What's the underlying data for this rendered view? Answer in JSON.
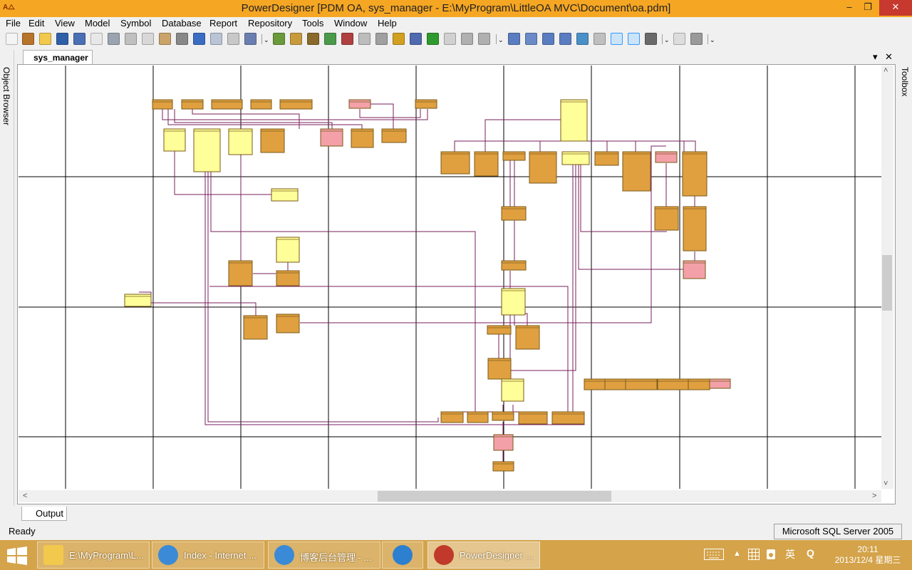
{
  "window": {
    "app_icon_text": "A⧍",
    "title": "PowerDesigner [PDM OA, sys_manager - E:\\MyProgram\\LittleOA MVC\\Document\\oa.pdm]",
    "minimize_glyph": "–",
    "restore_glyph": "❐",
    "close_glyph": "✕"
  },
  "menu": [
    {
      "label": "File"
    },
    {
      "label": "Edit"
    },
    {
      "label": "View"
    },
    {
      "label": "Model"
    },
    {
      "label": "Symbol"
    },
    {
      "label": "Database"
    },
    {
      "label": "Report"
    },
    {
      "label": "Repository"
    },
    {
      "label": "Tools"
    },
    {
      "label": "Window"
    },
    {
      "label": "Help"
    }
  ],
  "toolbar": {
    "overflow_glyph": "⌄",
    "buttons": [
      {
        "icon": "new-model-icon",
        "color": "#f4f4f4"
      },
      {
        "icon": "new-project-icon",
        "color": "#b8742a"
      },
      {
        "icon": "open-folder-icon",
        "color": "#f2c94c"
      },
      {
        "icon": "save-icon",
        "color": "#2f5fa8"
      },
      {
        "icon": "save-all-icon",
        "color": "#4a6fb5"
      },
      {
        "icon": "print-preview-icon",
        "color": "#e8e8e8"
      },
      {
        "icon": "print-icon",
        "color": "#9aa4b0"
      },
      {
        "icon": "cut-icon",
        "color": "#c0c0c0"
      },
      {
        "icon": "copy-icon",
        "color": "#d8d8d8"
      },
      {
        "icon": "paste-icon",
        "color": "#c9a36a"
      },
      {
        "icon": "delete-icon",
        "color": "#888888"
      },
      {
        "icon": "undo-icon",
        "color": "#3a6cc4"
      },
      {
        "icon": "redo-icon",
        "color": "#b9c4d6"
      },
      {
        "icon": "properties-icon",
        "color": "#c8c8c8"
      },
      {
        "icon": "check-model-icon",
        "color": "#6a7fb0"
      },
      {
        "icon": "new-table-icon",
        "color": "#6a9a3a"
      },
      {
        "icon": "browse-icon",
        "color": "#c79a3c"
      },
      {
        "icon": "find-icon",
        "color": "#8a6a2a"
      },
      {
        "icon": "refresh-icon",
        "color": "#4a9a4a"
      },
      {
        "icon": "impact-icon",
        "color": "#b04040"
      },
      {
        "icon": "shape-icon",
        "color": "#bdbdbd"
      },
      {
        "icon": "format-icon",
        "color": "#a0a0a0"
      },
      {
        "icon": "pen-icon",
        "color": "#d2a020"
      },
      {
        "icon": "fill-icon",
        "color": "#506ab0"
      },
      {
        "icon": "text-a-icon",
        "color": "#2e9a2e"
      },
      {
        "icon": "align-icon",
        "color": "#d0d0d0"
      },
      {
        "icon": "back-icon",
        "color": "#b0b0b0"
      },
      {
        "icon": "forward-icon",
        "color": "#b0b0b0"
      },
      {
        "icon": "pointer-icon",
        "color": "#5a7cc0"
      },
      {
        "icon": "grabber-icon",
        "color": "#6a8ac8"
      },
      {
        "icon": "zoom-in-icon",
        "color": "#5a7cc0"
      },
      {
        "icon": "zoom-out-icon",
        "color": "#5a7cc0"
      },
      {
        "icon": "zoom-fit-icon",
        "color": "#4a90c8"
      },
      {
        "icon": "zoom-page-icon",
        "color": "#bfbfbf"
      },
      {
        "icon": "grid-icon",
        "color": "#5a7cc0",
        "pressed": true
      },
      {
        "icon": "list-view-icon",
        "color": "#4a6aa8",
        "pressed": true
      },
      {
        "icon": "table-view-icon",
        "color": "#6a6a6a"
      },
      {
        "icon": "page-icon",
        "color": "#dddddd"
      },
      {
        "icon": "printer-icon",
        "color": "#9a9a9a"
      }
    ]
  },
  "panels": {
    "left": "Object Browser",
    "right": "Toolbox"
  },
  "document": {
    "tab": "sys_manager",
    "menu_glyph": "▾",
    "close_glyph": "✕"
  },
  "scroll_glyphs": {
    "up": "˄",
    "down": "˅",
    "left": "˂",
    "right": "˃"
  },
  "output_tab": "Output",
  "status": {
    "left": "Ready",
    "right": "Microsoft SQL Server 2005"
  },
  "taskbar": {
    "tasks": [
      {
        "label": "E:\\MyProgram\\L...",
        "icon": "folder-icon",
        "color": "#f2c94c"
      },
      {
        "label": "Index - Internet ...",
        "icon": "ie-icon",
        "color": "#3a8ad8"
      },
      {
        "label": "博客后台管理 - ...",
        "icon": "ie-icon",
        "color": "#3a8ad8"
      },
      {
        "label": "",
        "icon": "qq-browser-icon",
        "color": "#2d7fd0"
      },
      {
        "label": "PowerDesigner ...",
        "icon": "powerdesigner-icon",
        "color": "#c0392b",
        "active": true
      }
    ],
    "tray": {
      "ime": "英",
      "q": "Q",
      "time": "20:11",
      "date": "2013/12/4 星期三"
    }
  },
  "diagram": {
    "colors": {
      "table": "#e0a040",
      "table_light": "#ffff99",
      "table_pink": "#f4a0a8",
      "link": "#7a1f5c",
      "gridline": "#000000"
    }
  }
}
